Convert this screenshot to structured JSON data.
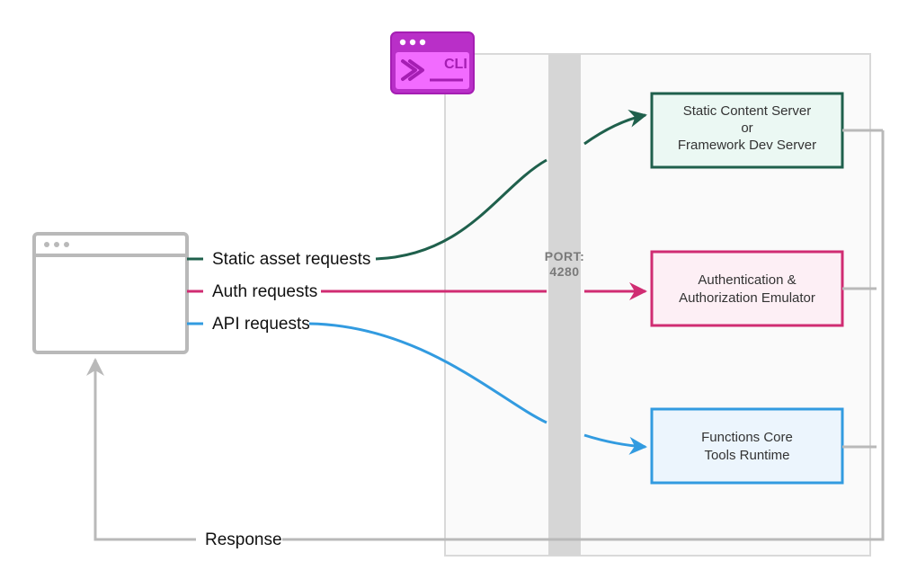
{
  "diagram": {
    "cli_label": "CLI",
    "port_label": "PORT:",
    "port_value": "4280",
    "requests": {
      "static": "Static asset requests",
      "auth": "Auth requests",
      "api": "API requests",
      "response": "Response"
    },
    "services": {
      "static_line1": "Static Content Server",
      "static_line2": "or",
      "static_line3": "Framework  Dev  Server",
      "auth_line1": "Authentication &",
      "auth_line2": "Authorization Emulator",
      "func_line1": "Functions Core",
      "func_line2": "Tools Runtime"
    },
    "colors": {
      "green": "#1f604c",
      "pink": "#d02c72",
      "blue": "#329be0",
      "gray": "#b9b9b9",
      "panel": "#fafafa",
      "port": "#d6d6d6"
    }
  }
}
